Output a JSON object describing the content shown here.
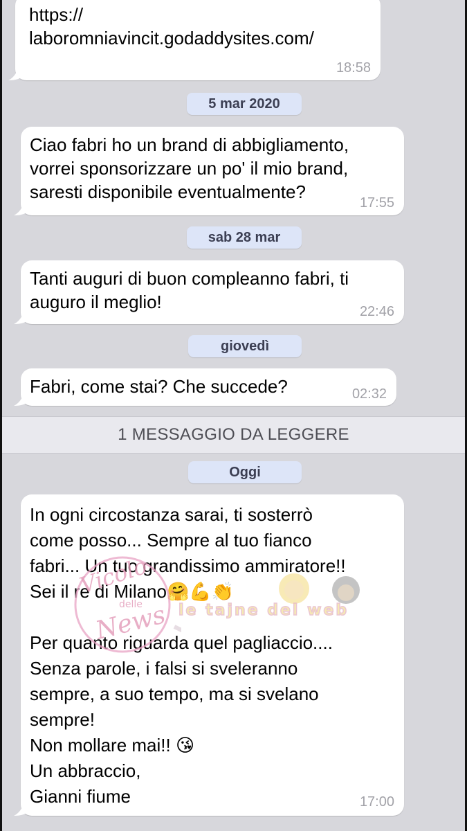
{
  "messages": [
    {
      "text": "https://\nlaboromniavincit.godaddysites.com/",
      "time": "18:58"
    },
    {
      "text": "Ciao fabri ho un brand di abbigliamento,\nvorrei sponsorizzare un po' il mio brand,\nsaresti disponibile eventualmente?",
      "time": "17:55"
    },
    {
      "text": "Tanti auguri di buon compleanno fabri, ti\naugurо il meglio!",
      "time": "22:46"
    },
    {
      "text": "Fabri, come stai? Che succede?",
      "time": "02:32"
    },
    {
      "text": "In ogni circostanza sarai, ti sosterrò\ncome posso... Sempre al tuo fianco\nfabri... Un tuo grandissimo ammiratore!!\nSei il re di Milano🤗💪👏\n\nPer quanto riguarda quel pagliaccio....\nSenza parole, i falsi si sveleranno\nsempre, a suo tempo, ma si svelano\nsempre!\nNon mollare mai!! 😘\nUn abbraccio,\nGianni fiume",
      "time": "17:00"
    }
  ],
  "dates": [
    "5 mar 2020",
    "sab 28 mar",
    "giovedì",
    "Oggi"
  ],
  "unread_banner": "1 MESSAGGIO DA LEGGERE",
  "watermarks": {
    "left_lines": [
      "Vicolo",
      "delle",
      "News"
    ],
    "right_text": "le tajne del web"
  },
  "colors": {
    "background": "#d7d7dc",
    "bubble": "#ffffff",
    "date_pill": "#dde5f8",
    "timestamp": "#a2a2a8"
  }
}
